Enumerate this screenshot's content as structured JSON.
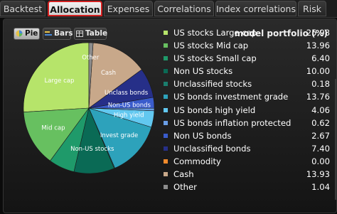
{
  "tabs": [
    {
      "label": "Backtest",
      "active": false
    },
    {
      "label": "Allocation",
      "active": true
    },
    {
      "label": "Expenses",
      "active": false
    },
    {
      "label": "Correlations",
      "active": false
    },
    {
      "label": "Index correlations",
      "active": false
    },
    {
      "label": "Risk",
      "active": false
    }
  ],
  "view_buttons": {
    "pie": "Pie",
    "bars": "Bars",
    "table": "Table",
    "selected": "Pie"
  },
  "portfolio_title": "model portfolio (%)",
  "chart_data": {
    "type": "pie",
    "title": "",
    "slices": [
      {
        "label": "US stocks Large cap",
        "pie_label": "Large cap",
        "value": 25.98,
        "color": "#b6e46a"
      },
      {
        "label": "US stocks Mid cap",
        "pie_label": "Mid cap",
        "value": 13.96,
        "color": "#67c060"
      },
      {
        "label": "US stocks Small cap",
        "pie_label": "",
        "value": 6.4,
        "color": "#1f9a6a"
      },
      {
        "label": "Non US stocks",
        "pie_label": "Non-US stocks",
        "value": 10.0,
        "color": "#0a6a55"
      },
      {
        "label": "Unclassified stocks",
        "pie_label": "",
        "value": 0.18,
        "color": "#1a7d6d"
      },
      {
        "label": "US bonds investment grade",
        "pie_label": "Invest grade",
        "value": 13.76,
        "color": "#2da2bb"
      },
      {
        "label": "US bonds high yield",
        "pie_label": "High yield",
        "value": 4.06,
        "color": "#62c8f0"
      },
      {
        "label": "US bonds inflation protected",
        "pie_label": "",
        "value": 0.62,
        "color": "#6a9ee6"
      },
      {
        "label": "Non US bonds",
        "pie_label": "Non-US bonds",
        "value": 2.67,
        "color": "#3a5ccc"
      },
      {
        "label": "Unclassified bonds",
        "pie_label": "Unclass bonds",
        "value": 7.4,
        "color": "#262f88"
      },
      {
        "label": "Commodity",
        "pie_label": "",
        "value": 0.0,
        "color": "#f08a2c"
      },
      {
        "label": "Cash",
        "pie_label": "Cash",
        "value": 13.93,
        "color": "#c8a88a"
      },
      {
        "label": "Other",
        "pie_label": "Other",
        "value": 1.04,
        "color": "#8c8c8c"
      }
    ],
    "legend_position": "right"
  }
}
